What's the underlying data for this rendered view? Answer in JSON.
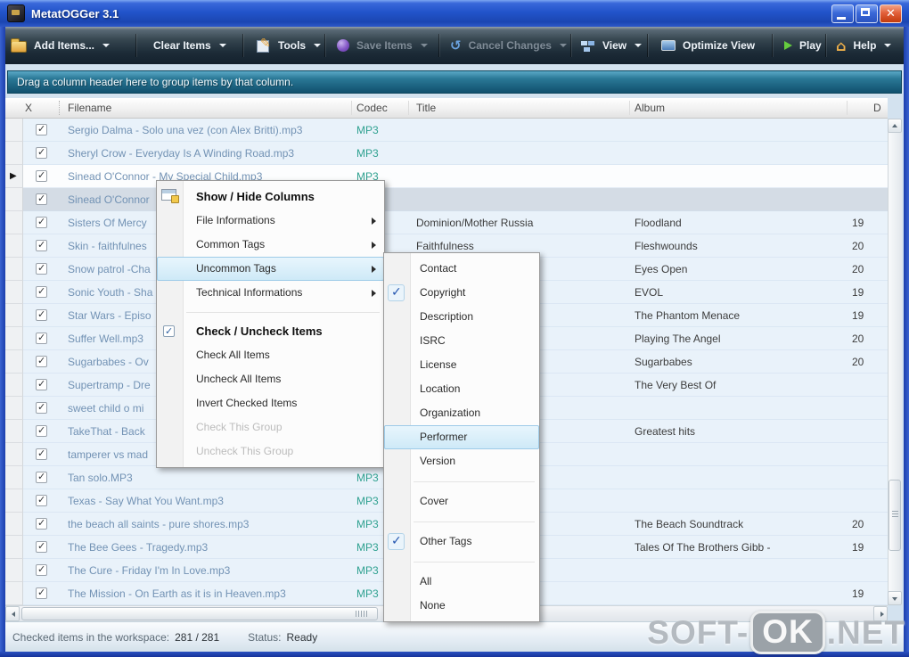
{
  "window": {
    "title": "MetatOGGer 3.1",
    "controls": [
      "minimize",
      "maximize",
      "close"
    ]
  },
  "toolbar": {
    "items": [
      {
        "label": "Add Items...",
        "icon": "folder-icon",
        "dropdown": true,
        "disabled": false
      },
      {
        "label": "Clear Items",
        "icon": null,
        "dropdown": true,
        "disabled": false
      },
      {
        "label": "Tools",
        "icon": "edit-icon",
        "dropdown": true,
        "disabled": false
      },
      {
        "label": "Save Items",
        "icon": "save-icon",
        "dropdown": true,
        "disabled": true
      },
      {
        "label": "Cancel Changes",
        "icon": "undo-icon",
        "dropdown": true,
        "disabled": true
      },
      {
        "label": "View",
        "icon": "view-icon",
        "dropdown": true,
        "disabled": false
      },
      {
        "label": "Optimize View",
        "icon": "screen-icon",
        "dropdown": false,
        "disabled": false
      },
      {
        "label": "Play",
        "icon": "play-icon",
        "dropdown": false,
        "disabled": false
      },
      {
        "label": "Help",
        "icon": "home-icon",
        "dropdown": true,
        "disabled": false
      }
    ]
  },
  "group_bar": {
    "hint": "Drag a column header here to group items by that column."
  },
  "table": {
    "columns": [
      {
        "label": "X"
      },
      {
        "label": "Filename"
      },
      {
        "label": "Codec"
      },
      {
        "label": "Title"
      },
      {
        "label": "Album"
      },
      {
        "label": "D"
      }
    ],
    "rows": [
      {
        "checked": true,
        "filename": "Sergio Dalma - Solo una vez (con Alex Britti).mp3",
        "codec": "MP3",
        "title": "",
        "album": "",
        "date": "",
        "state": "",
        "marker": false
      },
      {
        "checked": true,
        "filename": "Sheryl Crow - Everyday Is A Winding Road.mp3",
        "codec": "MP3",
        "title": "",
        "album": "",
        "date": "",
        "state": "",
        "marker": false
      },
      {
        "checked": true,
        "filename": "Sinead O'Connor - My Special Child.mp3",
        "codec": "MP3",
        "title": "",
        "album": "",
        "date": "",
        "state": "selected",
        "marker": true
      },
      {
        "checked": true,
        "filename": "Sinead O'Connor",
        "codec": "",
        "title": "",
        "album": "",
        "date": "",
        "state": "hot",
        "marker": false
      },
      {
        "checked": true,
        "filename": "Sisters Of Mercy",
        "codec": "",
        "title": "Dominion/Mother Russia",
        "album": "Floodland",
        "date": "19",
        "state": "",
        "marker": false
      },
      {
        "checked": true,
        "filename": "Skin - faithfulnes",
        "codec": "",
        "title": "Faithfulness",
        "album": "Fleshwounds",
        "date": "20",
        "state": "",
        "marker": false
      },
      {
        "checked": true,
        "filename": "Snow patrol -Cha",
        "codec": "",
        "title": "",
        "album": "Eyes Open",
        "date": "20",
        "state": "",
        "marker": false
      },
      {
        "checked": true,
        "filename": "Sonic Youth - Sha",
        "codec": "",
        "title": "",
        "album": "EVOL",
        "date": "19",
        "state": "",
        "marker": false
      },
      {
        "checked": true,
        "filename": "Star Wars - Episo",
        "codec": "",
        "title": "",
        "album": "The Phantom Menace",
        "date": "19",
        "state": "",
        "marker": false
      },
      {
        "checked": true,
        "filename": "Suffer Well.mp3",
        "codec": "",
        "title": "",
        "album": "Playing The Angel",
        "date": "20",
        "state": "",
        "marker": false
      },
      {
        "checked": true,
        "filename": "Sugarbabes - Ov",
        "codec": "",
        "title": "",
        "album": "Sugarbabes",
        "date": "20",
        "state": "",
        "marker": false
      },
      {
        "checked": true,
        "filename": "Supertramp - Dre",
        "codec": "",
        "title": "",
        "album": "The Very Best Of",
        "date": "",
        "state": "",
        "marker": false
      },
      {
        "checked": true,
        "filename": "sweet child o mi",
        "codec": "",
        "title": "",
        "album": "",
        "date": "",
        "state": "",
        "marker": false
      },
      {
        "checked": true,
        "filename": "TakeThat - Back",
        "codec": "",
        "title": "",
        "album": "Greatest hits",
        "date": "",
        "state": "",
        "marker": false
      },
      {
        "checked": true,
        "filename": "tamperer vs mad",
        "codec": "",
        "title": "",
        "album": "",
        "date": "",
        "state": "",
        "marker": false
      },
      {
        "checked": true,
        "filename": "Tan solo.MP3",
        "codec": "MP3",
        "title": "",
        "album": "",
        "date": "",
        "state": "",
        "marker": false
      },
      {
        "checked": true,
        "filename": "Texas - Say What You Want.mp3",
        "codec": "MP3",
        "title": "",
        "album": "",
        "date": "",
        "state": "",
        "marker": false
      },
      {
        "checked": true,
        "filename": "the beach all saints - pure shores.mp3",
        "codec": "MP3",
        "title": "",
        "album": "The Beach Soundtrack",
        "date": "20",
        "state": "",
        "marker": false
      },
      {
        "checked": true,
        "filename": "The Bee Gees - Tragedy.mp3",
        "codec": "MP3",
        "title": "",
        "album": "Tales Of The Brothers Gibb -",
        "date": "19",
        "state": "",
        "marker": false
      },
      {
        "checked": true,
        "filename": "The Cure - Friday I'm In Love.mp3",
        "codec": "MP3",
        "title": "",
        "album": "",
        "date": "",
        "state": "",
        "marker": false
      },
      {
        "checked": true,
        "filename": "The Mission - On Earth as it is in Heaven.mp3",
        "codec": "MP3",
        "title": "",
        "album": "",
        "date": "19",
        "state": "",
        "marker": false
      }
    ]
  },
  "context_menu": {
    "items": [
      {
        "type": "header",
        "label": "Show / Hide Columns",
        "icon": "columns-icon"
      },
      {
        "type": "item",
        "label": "File Informations",
        "submenu": true
      },
      {
        "type": "item",
        "label": "Common Tags",
        "submenu": true
      },
      {
        "type": "item",
        "label": "Uncommon Tags",
        "submenu": true,
        "highlighted": true
      },
      {
        "type": "item",
        "label": "Technical Informations",
        "submenu": true
      },
      {
        "type": "separator"
      },
      {
        "type": "header",
        "label": "Check / Uncheck Items",
        "icon": "checkbox-icon"
      },
      {
        "type": "item",
        "label": "Check All Items"
      },
      {
        "type": "item",
        "label": "Uncheck All Items"
      },
      {
        "type": "item",
        "label": "Invert Checked Items"
      },
      {
        "type": "item",
        "label": "Check This Group",
        "disabled": true
      },
      {
        "type": "item",
        "label": "Uncheck This Group",
        "disabled": true
      }
    ]
  },
  "column_submenu": {
    "items": [
      {
        "type": "item",
        "label": "Contact"
      },
      {
        "type": "item",
        "label": "Copyright",
        "checked": true
      },
      {
        "type": "item",
        "label": "Description"
      },
      {
        "type": "item",
        "label": "ISRC"
      },
      {
        "type": "item",
        "label": "License"
      },
      {
        "type": "item",
        "label": "Location"
      },
      {
        "type": "item",
        "label": "Organization"
      },
      {
        "type": "item",
        "label": "Performer",
        "highlighted": true
      },
      {
        "type": "item",
        "label": "Version"
      },
      {
        "type": "separator"
      },
      {
        "type": "item",
        "label": "Cover"
      },
      {
        "type": "separator"
      },
      {
        "type": "item",
        "label": "Other Tags",
        "checked": true
      },
      {
        "type": "separator"
      },
      {
        "type": "item",
        "label": "All"
      },
      {
        "type": "item",
        "label": "None"
      }
    ]
  },
  "status_bar": {
    "checked_items_label": "Checked items in the workspace:",
    "checked_items_value": "281 / 281",
    "status_label": "Status:",
    "status_value": "Ready"
  },
  "watermark": {
    "text_prefix": "SOFT-",
    "badge_text": "OK",
    "text_suffix": ".NET"
  },
  "colors": {
    "titlebar_blue": "#2254ca",
    "toolbar_dark": "#1d2c38",
    "groupbar_teal": "#2a7896",
    "row_bg": "#e9f2fa",
    "filename_text": "#7292b4",
    "codec_text": "#2fa190",
    "menu_highlight": "#cde9f7",
    "check_blue": "#2456b0"
  }
}
